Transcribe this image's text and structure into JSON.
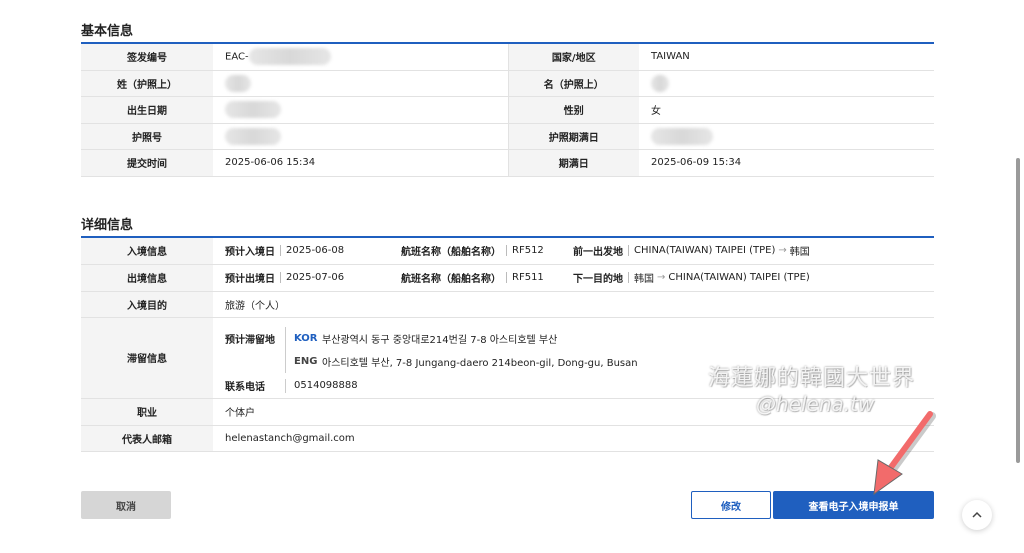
{
  "basic": {
    "title": "基本信息",
    "rows": [
      {
        "l1": "签发编号",
        "v1": "EAC-",
        "l2": "国家/地区",
        "v2": "TAIWAN"
      },
      {
        "l1": "姓（护照上）",
        "v1": "",
        "l2": "名（护照上）",
        "v2": ""
      },
      {
        "l1": "出生日期",
        "v1": "",
        "l2": "性别",
        "v2": "女"
      },
      {
        "l1": "护照号",
        "v1": "",
        "l2": "护照期满日",
        "v2": ""
      },
      {
        "l1": "提交时间",
        "v1": "2025-06-06 15:34",
        "l2": "期满日",
        "v2": "2025-06-09 15:34"
      }
    ]
  },
  "detail": {
    "title": "详细信息",
    "entry": {
      "label": "入境信息",
      "date_label": "预计入境日",
      "date": "2025-06-08",
      "flight_label": "航班名称（船舶名称）",
      "flight": "RF512",
      "place_label": "前一出发地",
      "from": "CHINA(TAIWAN) TAIPEI (TPE)",
      "to": "韩国"
    },
    "exit": {
      "label": "出境信息",
      "date_label": "预计出境日",
      "date": "2025-07-06",
      "flight_label": "航班名称（船舶名称）",
      "flight": "RF511",
      "place_label": "下一目的地",
      "from": "韩国",
      "to": "CHINA(TAIWAN) TAIPEI (TPE)"
    },
    "purpose": {
      "label": "入境目的",
      "value": "旅游（个人）"
    },
    "stay": {
      "label": "滞留信息",
      "addr_label": "预计滞留地",
      "kor_tag": "KOR",
      "kor_addr": "부산광역시 동구 중앙대로214번길 7-8 아스티호텔 부산",
      "eng_tag": "ENG",
      "eng_addr": "아스티호텔 부산, 7-8 Jungang-daero 214beon-gil, Dong-gu, Busan",
      "phone_label": "联系电话",
      "phone": "0514098888"
    },
    "job": {
      "label": "职业",
      "value": "个体户"
    },
    "email": {
      "label": "代表人邮箱",
      "value": "helenastanch@gmail.com"
    }
  },
  "buttons": {
    "cancel": "取消",
    "edit": "修改",
    "view": "查看电子入境申报单"
  },
  "watermark": {
    "line1": "海蓮娜的韓國大世界",
    "line2": "@helena.tw"
  },
  "colors": {
    "accent": "#1f5fbf",
    "annotation_arrow": "#f26b6b"
  }
}
